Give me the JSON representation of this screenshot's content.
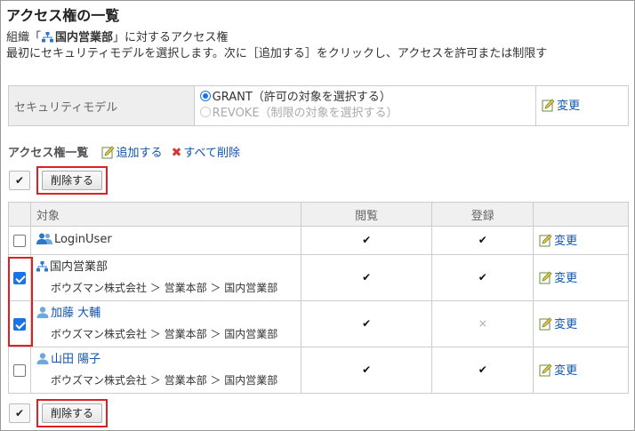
{
  "page": {
    "title": "アクセス権の一覧",
    "subline_prefix": "組織「",
    "org_name": "国内営業部",
    "subline_suffix": "」に対するアクセス権",
    "intro": "最初にセキュリティモデルを選択します。次に［追加する］をクリックし、アクセスを許可または制限す"
  },
  "security": {
    "label": "セキュリティモデル",
    "grant": "GRANT（許可の対象を選択する）",
    "revoke": "REVOKE（制限の対象を選択する）",
    "selected": "GRANT",
    "edit_label": "変更"
  },
  "list": {
    "heading": "アクセス権一覧",
    "add_label": "追加する",
    "delete_all_label": "すべて削除"
  },
  "toolbar": {
    "check_all_glyph": "✔",
    "delete_label": "削除する"
  },
  "table": {
    "headers": {
      "target": "対象",
      "view": "閲覧",
      "register": "登録"
    },
    "rows": [
      {
        "type": "group",
        "name": "LoginUser",
        "path": "",
        "checked": false,
        "view": "✔",
        "register": "✔",
        "edit": "変更"
      },
      {
        "type": "org",
        "name": "国内営業部",
        "path": "ボウズマン株式会社 ＞ 営業本部 ＞ 国内営業部",
        "checked": true,
        "view": "✔",
        "register": "✔",
        "edit": "変更"
      },
      {
        "type": "user",
        "name": "加藤 大輔",
        "path": "ボウズマン株式会社 ＞ 営業本部 ＞ 国内営業部",
        "checked": true,
        "view": "✔",
        "register": "×",
        "edit": "変更"
      },
      {
        "type": "user",
        "name": "山田 陽子",
        "path": "ボウズマン株式会社 ＞ 営業本部 ＞ 国内営業部",
        "checked": false,
        "view": "✔",
        "register": "✔",
        "edit": "変更"
      }
    ]
  },
  "colors": {
    "link": "#1155aa",
    "highlight": "#e02020",
    "checkbox_on": "#1a73e8"
  }
}
